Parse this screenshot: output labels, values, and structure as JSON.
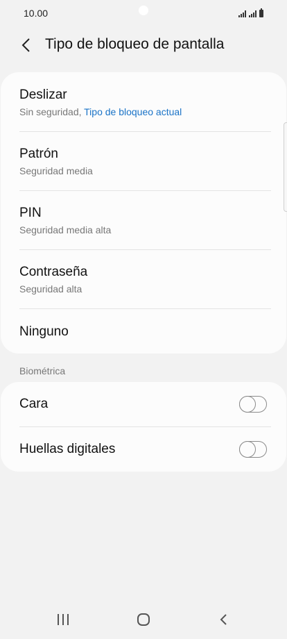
{
  "status_bar": {
    "time": "10.00",
    "icons": [
      "signal-icon",
      "signal-icon",
      "battery-icon"
    ]
  },
  "header": {
    "title": "Tipo de bloqueo de pantalla",
    "back_icon": "chevron-left-icon"
  },
  "lock_types": [
    {
      "title": "Deslizar",
      "subtitle": "Sin seguridad, ",
      "subtitle_accent": "Tipo de bloqueo actual"
    },
    {
      "title": "Patrón",
      "subtitle": "Seguridad media"
    },
    {
      "title": "PIN",
      "subtitle": "Seguridad media alta"
    },
    {
      "title": "Contraseña",
      "subtitle": "Seguridad alta"
    },
    {
      "title": "Ninguno"
    }
  ],
  "biometrics": {
    "section_label": "Biométrica",
    "items": [
      {
        "title": "Cara",
        "enabled": false
      },
      {
        "title": "Huellas digitales",
        "enabled": false
      }
    ]
  },
  "nav_bar": {
    "icons": [
      "recent-apps-icon",
      "home-icon",
      "back-icon"
    ]
  },
  "colors": {
    "background": "#f2f2f2",
    "card": "#fcfcfc",
    "accent": "#1a73c7",
    "secondary_text": "#777777"
  }
}
